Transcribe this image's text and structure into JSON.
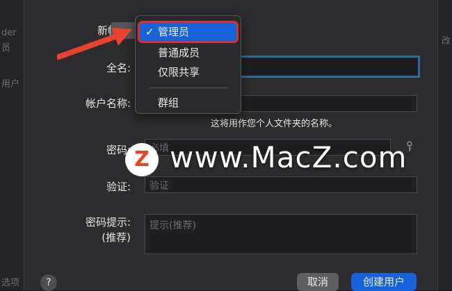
{
  "background": {
    "left_fragments": [
      "der",
      "员",
      "用户",
      "选项"
    ],
    "right_fragment": "改"
  },
  "form": {
    "new_account_label": "新帐户:",
    "full_name_label": "全名:",
    "account_name_label": "帐户名称:",
    "account_name_hint": "这将用作您个人文件夹的名称。",
    "password_label": "密码:",
    "password_placeholder": "必填",
    "verify_label": "验证:",
    "verify_placeholder": "验证",
    "password_hint_label": "密码提示:",
    "password_hint_sub": "(推荐)",
    "password_hint_placeholder": "提示(推荐)"
  },
  "account_type_menu": {
    "items": [
      {
        "label": "管理员",
        "selected": true
      },
      {
        "label": "普通成员",
        "selected": false
      },
      {
        "label": "仅限共享",
        "selected": false
      },
      {
        "label": "群组",
        "selected": false
      }
    ],
    "check": "✓"
  },
  "buttons": {
    "help": "?",
    "cancel": "取消",
    "create": "创建用户"
  },
  "watermark": {
    "logo_letter": "Z",
    "text": "www.MacZ.com"
  },
  "colors": {
    "dialog": "#2c2c2e",
    "accent": "#1862d9",
    "highlight_border": "#d93131",
    "arrow": "#e8432e"
  }
}
